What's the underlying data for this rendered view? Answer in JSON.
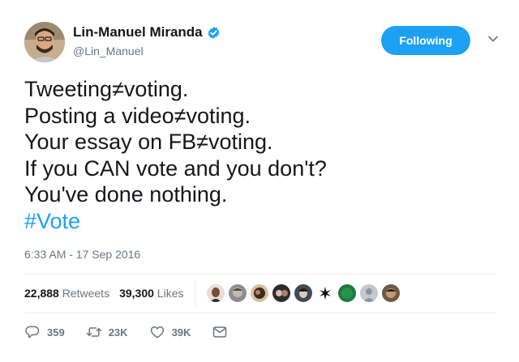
{
  "user": {
    "display_name": "Lin-Manuel Miranda",
    "handle": "@Lin_Manuel",
    "verified": true,
    "follow_label": "Following"
  },
  "tweet": {
    "lines": [
      "Tweeting≠voting.",
      "Posting a video≠voting.",
      "Your essay on FB≠voting.",
      "If you CAN vote and you don't?",
      "You've done nothing."
    ],
    "hashtag": "#Vote",
    "timestamp": "6:33 AM - 17 Sep 2016"
  },
  "stats": {
    "retweets_count": "22,888",
    "retweets_label": "Retweets",
    "likes_count": "39,300",
    "likes_label": "Likes"
  },
  "actions": {
    "reply_count": "359",
    "retweet_count": "23K",
    "like_count": "39K"
  },
  "colors": {
    "accent": "#1da1f2",
    "text": "#14171a",
    "muted": "#657786",
    "divider": "#e6ecf0"
  },
  "icons": [
    "verified-badge-icon",
    "chevron-down-icon",
    "reply-icon",
    "retweet-icon",
    "heart-icon",
    "direct-message-icon"
  ]
}
